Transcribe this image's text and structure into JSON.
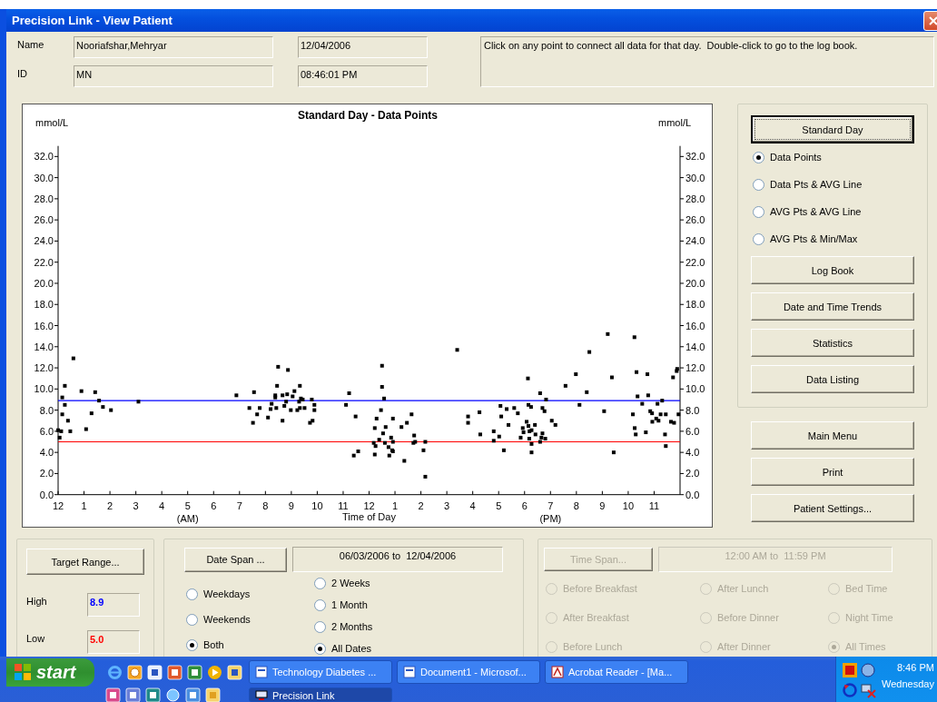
{
  "window": {
    "title": "Precision Link - View Patient"
  },
  "patient": {
    "name_label": "Name",
    "name": "Nooriafshar,Mehryar",
    "date": "12/04/2006",
    "id_label": "ID",
    "id": "MN",
    "time": "08:46:01 PM",
    "message": "Click on any point to connect all data for that day.  Double-click to go to the log book."
  },
  "chart": {
    "ylabel_right": "mmol/L",
    "midnight_label": "12",
    "pm_hour_labels": [
      "1",
      "2",
      "3",
      "4",
      "5",
      "6",
      "7",
      "8",
      "9",
      "10",
      "11"
    ],
    "chart_data": {
      "type": "scatter",
      "title": "Standard Day - Data Points",
      "xlabel": "Time of Day",
      "ylabel": "mmol/L",
      "xlim": [
        0,
        24
      ],
      "ylim": [
        0,
        33
      ],
      "xticks": [
        {
          "value": 1,
          "label": "1"
        },
        {
          "value": 2,
          "label": "2"
        },
        {
          "value": 3,
          "label": "3"
        },
        {
          "value": 4,
          "label": "4"
        },
        {
          "value": 5,
          "label": "5"
        },
        {
          "value": 6,
          "label": "6"
        },
        {
          "value": 7,
          "label": "7"
        },
        {
          "value": 8,
          "label": "8"
        },
        {
          "value": 9,
          "label": "9"
        },
        {
          "value": 10,
          "label": "10"
        },
        {
          "value": 11,
          "label": "11"
        },
        {
          "value": 12,
          "label": "12"
        }
      ],
      "yticks": [
        {
          "value": 0,
          "label": "0.0"
        },
        {
          "value": 2,
          "label": "2.0"
        },
        {
          "value": 4,
          "label": "4.0"
        },
        {
          "value": 6,
          "label": "6.0"
        },
        {
          "value": 8,
          "label": "8.0"
        },
        {
          "value": 10,
          "label": "10.0"
        },
        {
          "value": 12,
          "label": "12.0"
        },
        {
          "value": 14,
          "label": "14.0"
        },
        {
          "value": 16,
          "label": "16.0"
        },
        {
          "value": 18,
          "label": "18.0"
        },
        {
          "value": 20,
          "label": "20.0"
        },
        {
          "value": 22,
          "label": "22.0"
        },
        {
          "value": 24,
          "label": "24.0"
        },
        {
          "value": 26,
          "label": "26.0"
        },
        {
          "value": 28,
          "label": "28.0"
        },
        {
          "value": 30,
          "label": "30.0"
        },
        {
          "value": 32,
          "label": "32.0"
        }
      ],
      "annotations": [
        "(AM)",
        "(PM)"
      ],
      "ref_lines": [
        {
          "axis": "y",
          "value": 8.9,
          "color": "#0000ff"
        },
        {
          "axis": "y",
          "value": 5.0,
          "color": "#ff0000"
        }
      ],
      "x": [
        0,
        0.06,
        0.12,
        0.16,
        0.16,
        0.26,
        0.26,
        0.38,
        0.47,
        0.59,
        0.9,
        1.08,
        1.29,
        1.43,
        1.58,
        1.73,
        2.04,
        3.1,
        6.88,
        7.38,
        7.52,
        7.56,
        7.68,
        7.78,
        8.1,
        8.2,
        8.24,
        8.38,
        8.38,
        8.42,
        8.45,
        8.49,
        8.66,
        8.66,
        8.73,
        8.8,
        8.84,
        8.87,
        8.98,
        9.05,
        9.12,
        9.23,
        9.3,
        9.33,
        9.37,
        9.44,
        9.33,
        9.51,
        9.72,
        9.79,
        9.82,
        9.89,
        9.89,
        11.11,
        11.23,
        11.41,
        11.48,
        11.58,
        12.18,
        12.22,
        12.22,
        12.25,
        12.29,
        12.39,
        12.46,
        12.5,
        12.5,
        12.54,
        12.58,
        12.61,
        12.64,
        12.75,
        12.78,
        12.85,
        12.89,
        12.92,
        12.92,
        12.92,
        13.25,
        13.36,
        13.46,
        13.64,
        13.74,
        13.71,
        13.78,
        14.1,
        14.17,
        14.17,
        15.4,
        15.82,
        15.82,
        16.26,
        16.29,
        16.81,
        16.81,
        17.02,
        17.07,
        17.1,
        17.2,
        17.31,
        17.38,
        17.6,
        17.74,
        17.85,
        17.93,
        17.96,
        18.08,
        18.13,
        18.15,
        18.15,
        18.18,
        18.19,
        18.25,
        18.27,
        18.27,
        18.27,
        18.4,
        18.42,
        18.6,
        18.6,
        18.65,
        18.69,
        18.69,
        18.77,
        18.8,
        18.83,
        19.05,
        19.19,
        19.58,
        19.98,
        20.12,
        20.4,
        20.5,
        21.07,
        21.21,
        21.37,
        21.44,
        22.18,
        22.24,
        22.25,
        22.29,
        22.32,
        22.36,
        22.54,
        22.68,
        22.74,
        22.77,
        22.85,
        22.92,
        22.93,
        23.08,
        23.13,
        23.17,
        23.25,
        23.31,
        23.42,
        23.45,
        23.45,
        23.65,
        23.73,
        23.77,
        23.87,
        23.89,
        23.94
      ],
      "series": [
        {
          "color": "#000000",
          "values": [
            6.1,
            5.4,
            6.0,
            9.2,
            7.6,
            8.5,
            10.3,
            7.0,
            6.0,
            12.9,
            9.8,
            6.2,
            7.7,
            9.7,
            8.9,
            8.3,
            8.0,
            8.8,
            9.4,
            8.2,
            6.8,
            9.7,
            7.6,
            8.2,
            7.3,
            8.1,
            8.6,
            9.4,
            9.2,
            8.2,
            10.3,
            12.1,
            7.0,
            9.4,
            8.4,
            8.8,
            9.5,
            11.8,
            8.0,
            9.3,
            9.8,
            8.0,
            8.8,
            10.3,
            9.1,
            9.0,
            8.2,
            8.2,
            6.8,
            9.0,
            7.0,
            8.0,
            8.5,
            8.5,
            9.6,
            3.7,
            7.4,
            4.1,
            4.9,
            6.3,
            3.8,
            4.6,
            7.2,
            5.2,
            8.0,
            12.2,
            10.2,
            5.8,
            9.1,
            4.9,
            6.4,
            4.5,
            3.7,
            5.4,
            4.2,
            7.2,
            5.0,
            4.1,
            6.4,
            3.2,
            6.8,
            7.6,
            5.6,
            4.9,
            5.0,
            4.2,
            5.0,
            1.7,
            13.7,
            7.4,
            6.8,
            7.8,
            5.7,
            6.0,
            5.1,
            5.5,
            8.4,
            7.4,
            4.2,
            8.1,
            6.6,
            8.2,
            7.7,
            5.4,
            6.3,
            5.9,
            6.9,
            11.0,
            6.5,
            8.5,
            5.3,
            6.0,
            8.3,
            4.8,
            4.0,
            6.1,
            6.6,
            5.7,
            9.6,
            5.0,
            5.4,
            5.8,
            8.2,
            7.9,
            5.3,
            9.0,
            7.0,
            6.6,
            10.3,
            11.4,
            8.5,
            9.7,
            13.5,
            7.9,
            15.2,
            11.1,
            4.0,
            7.6,
            14.9,
            6.3,
            5.7,
            11.6,
            9.3,
            8.6,
            5.9,
            11.4,
            9.4,
            7.9,
            7.7,
            6.9,
            7.2,
            8.6,
            7.0,
            7.6,
            8.9,
            5.7,
            7.6,
            4.6,
            6.9,
            11.1,
            6.8,
            11.7,
            11.9,
            7.6
          ]
        }
      ]
    }
  },
  "view_panel": {
    "standard_day": {
      "label": "Standard Day",
      "default": true
    },
    "display_options": [
      {
        "label": "Data Points",
        "selected": true
      },
      {
        "label": "Data Pts & AVG Line",
        "selected": false
      },
      {
        "label": "AVG Pts & AVG Line",
        "selected": false
      },
      {
        "label": "AVG Pts & Min/Max",
        "selected": false
      }
    ],
    "reports": [
      "Log Book",
      "Date and Time Trends",
      "Statistics",
      "Data Listing"
    ]
  },
  "actions": [
    "Main Menu",
    "Print",
    "Patient Settings..."
  ],
  "target_range": {
    "button": "Target Range...",
    "high": {
      "label": "High",
      "value": "8.9",
      "color": "#0000ff"
    },
    "low": {
      "label": "Low",
      "value": "5.0",
      "color": "#ff0000"
    }
  },
  "date_filter": {
    "button": "Date Span ...",
    "span": "06/03/2006 to  12/04/2006",
    "day_options": [
      {
        "label": "Weekdays",
        "selected": false
      },
      {
        "label": "Weekends",
        "selected": false
      },
      {
        "label": "Both",
        "selected": true
      }
    ],
    "period_options": [
      {
        "label": "2 Weeks",
        "selected": false
      },
      {
        "label": "1 Month",
        "selected": false
      },
      {
        "label": "2 Months",
        "selected": false
      },
      {
        "label": "All Dates",
        "selected": true
      }
    ]
  },
  "time_filter": {
    "disabled": true,
    "button": "Time Span...",
    "span": "12:00 AM to  11:59 PM",
    "options": [
      {
        "label": "Before Breakfast",
        "selected": false
      },
      {
        "label": "After Lunch",
        "selected": false
      },
      {
        "label": "Bed Time",
        "selected": false
      },
      {
        "label": "After Breakfast",
        "selected": false
      },
      {
        "label": "Before Dinner",
        "selected": false
      },
      {
        "label": "Night Time",
        "selected": false
      },
      {
        "label": "Before Lunch",
        "selected": false
      },
      {
        "label": "After Dinner",
        "selected": false
      },
      {
        "label": "All Times",
        "selected": true
      }
    ]
  },
  "taskbar": {
    "start": "start",
    "task_rows": [
      [
        {
          "label": "Technology Diabetes ...",
          "selected": false
        },
        {
          "label": "Document1 - Microsof...",
          "selected": false
        },
        {
          "label": "Acrobat Reader - [Ma...",
          "selected": false
        }
      ],
      [
        {
          "label": "Precision Link",
          "selected": true
        }
      ]
    ],
    "clock": {
      "time": "8:46 PM",
      "day": "Wednesday"
    }
  }
}
